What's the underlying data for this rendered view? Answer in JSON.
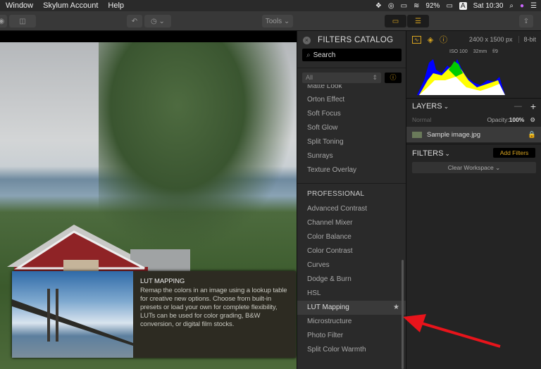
{
  "menubar": {
    "items": [
      "Window",
      "Skylum Account",
      "Help"
    ],
    "battery": "92%",
    "input": "A",
    "clock": "Sat 10:30"
  },
  "toolbar": {
    "tools_label": "Tools ⌄"
  },
  "catalog": {
    "title": "FILTERS CATALOG",
    "search_placeholder": "Search",
    "category": "All",
    "items_top": [
      "Matte Look",
      "Orton Effect",
      "Soft Focus",
      "Soft Glow",
      "Split Toning",
      "Sunrays",
      "Texture Overlay"
    ],
    "section": "PROFESSIONAL",
    "items_pro": [
      "Advanced Contrast",
      "Channel Mixer",
      "Color Balance",
      "Color Contrast",
      "Curves",
      "Dodge & Burn",
      "HSL",
      "LUT Mapping",
      "Microstructure",
      "Photo Filter",
      "Split Color Warmth"
    ],
    "selected": "LUT Mapping"
  },
  "tooltip": {
    "title": "LUT MAPPING",
    "body": "Remap the colors in an image using a lookup table for creative new options. Choose from built-in presets or load your own for complete flexibility, LUTs can be used for color grading, B&W conversion, or digital film stocks."
  },
  "info": {
    "dimensions": "2400 x 1500 px",
    "bitdepth": "8-bit",
    "iso": "ISO 100",
    "focal": "32mm",
    "aperture": "f/9"
  },
  "layers": {
    "title": "LAYERS",
    "blend": "Normal",
    "opacity_label": "Opacity:",
    "opacity": "100%",
    "layer_name": "Sample image.jpg"
  },
  "filters": {
    "title": "FILTERS",
    "add_label": "Add Filters",
    "clear_label": "Clear Workspace ⌄"
  },
  "colors": {
    "accent": "#d9a520",
    "arrow": "#e8141b"
  }
}
